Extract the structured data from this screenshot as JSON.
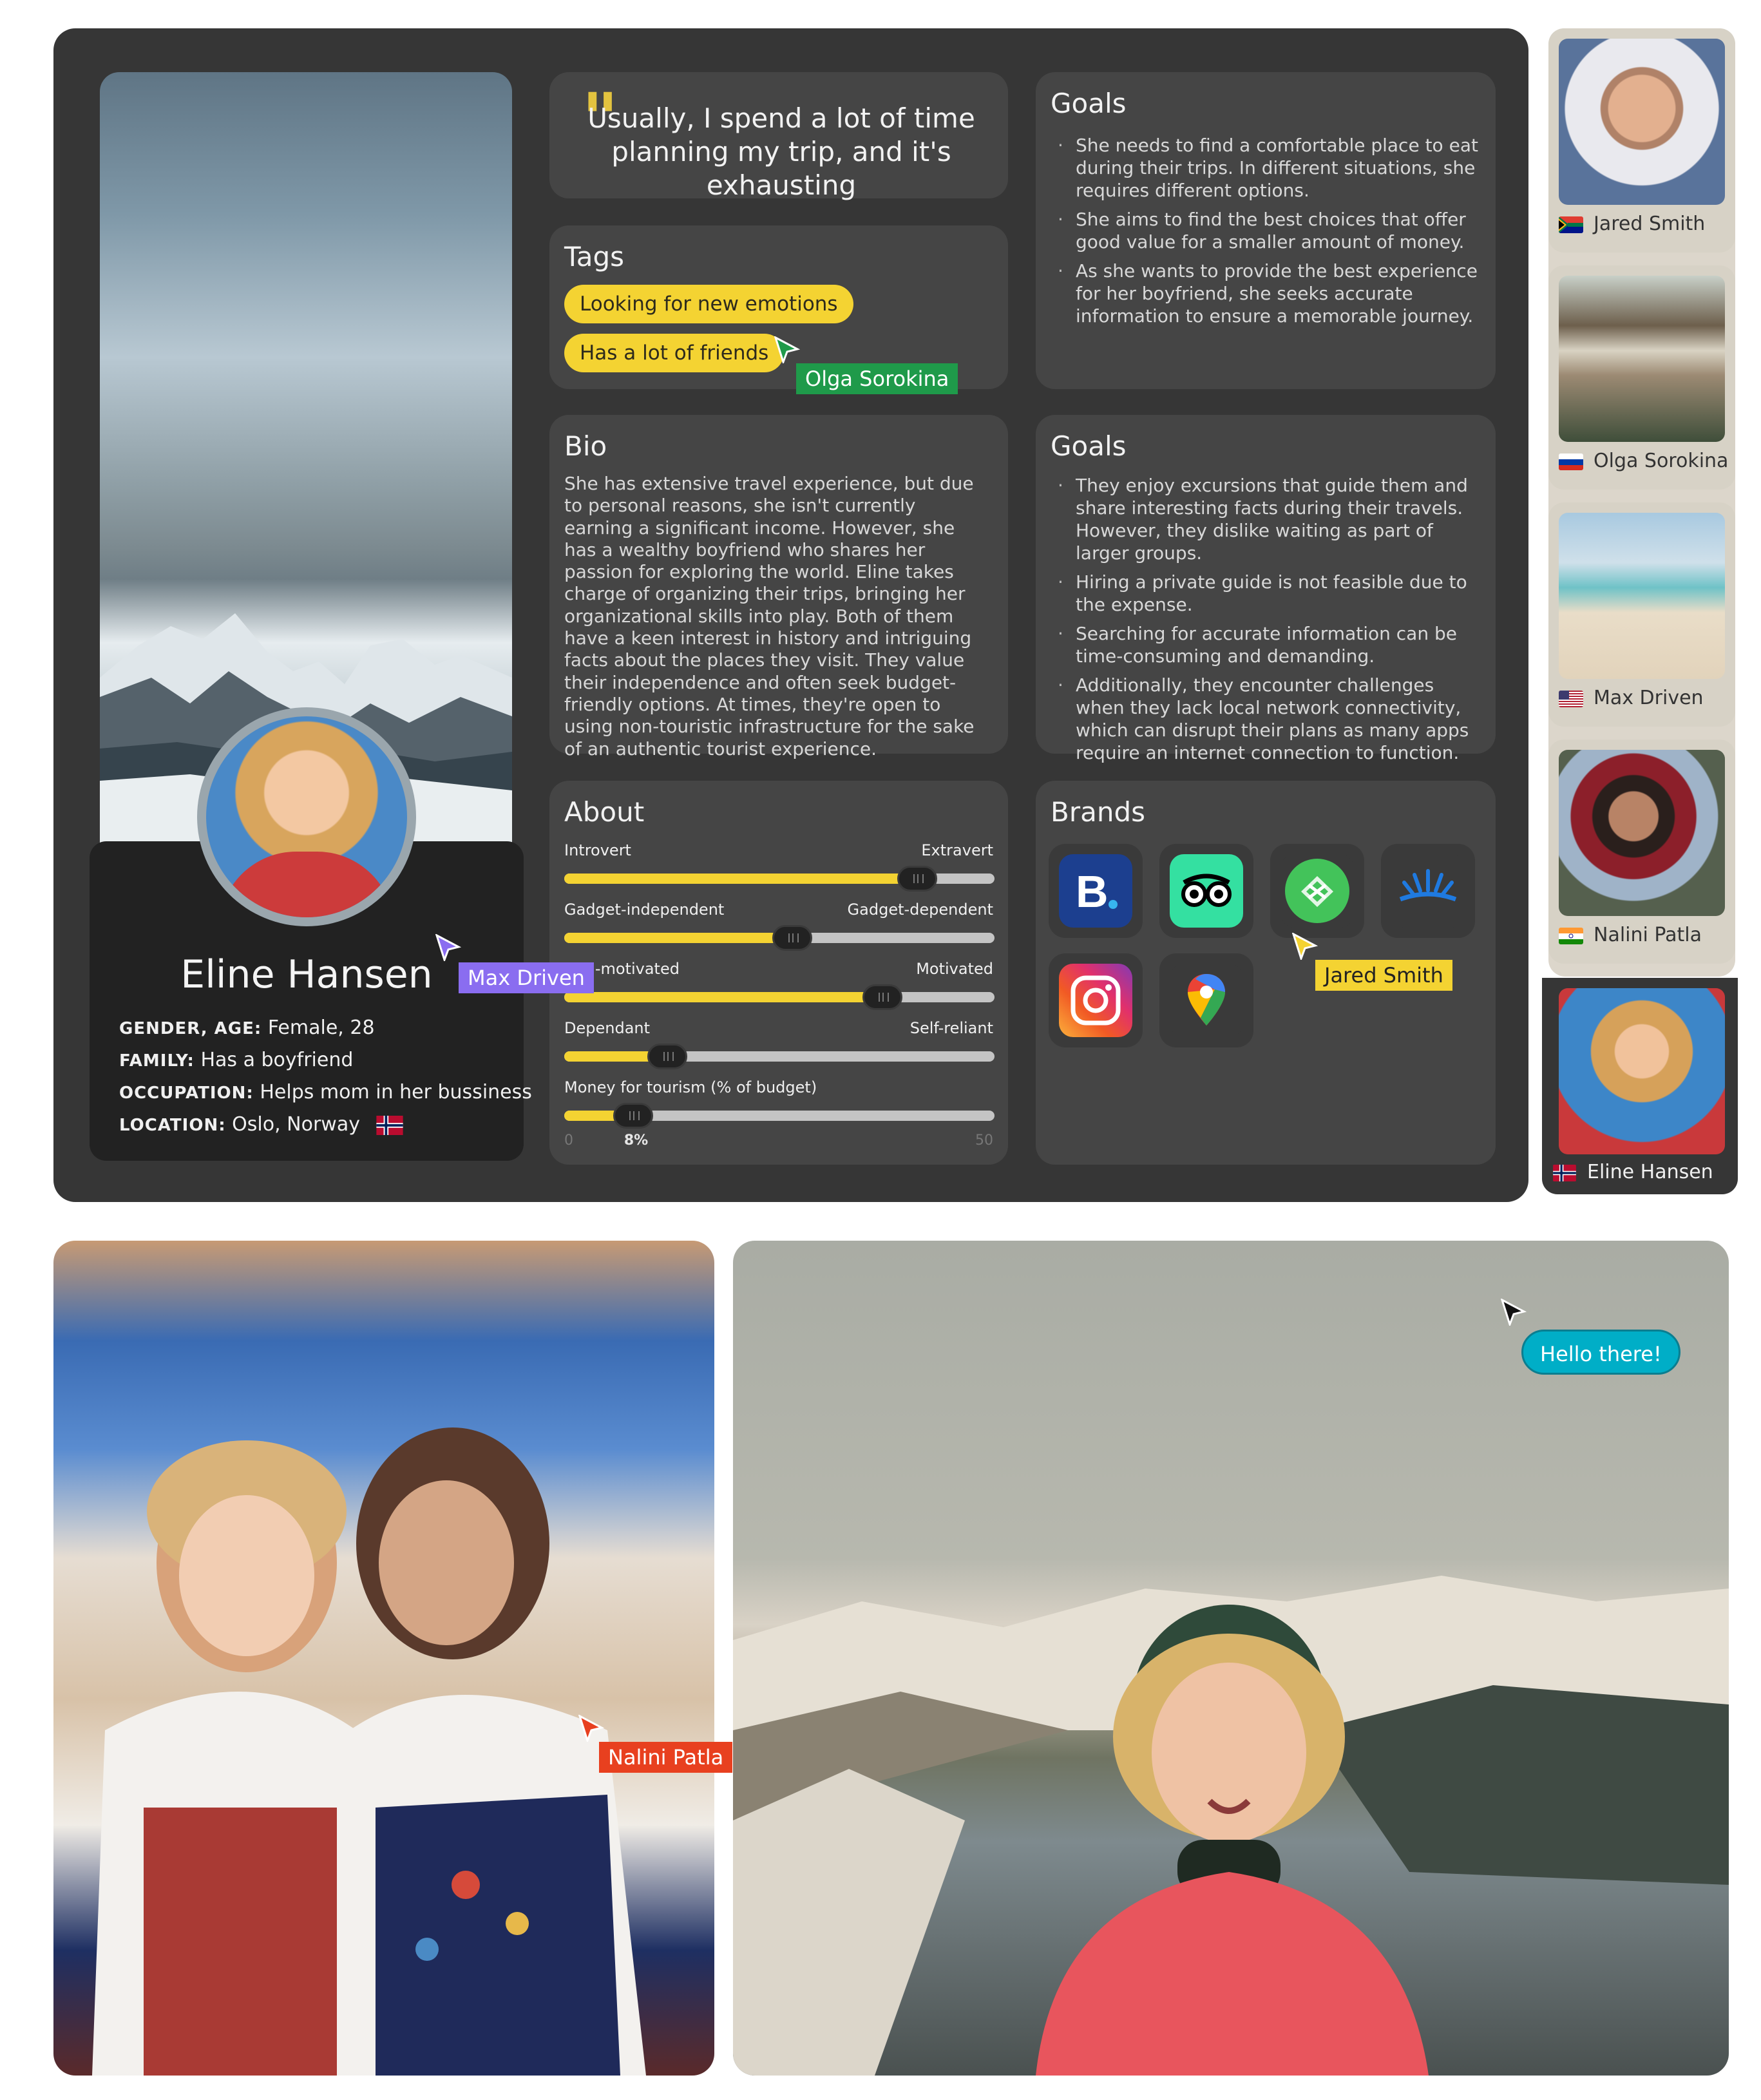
{
  "quote": "Usually, I spend a lot of time planning my trip, and it's exhausting",
  "profile": {
    "name": "Eline Hansen",
    "facts": [
      {
        "label": "GENDER, AGE:",
        "value": "Female, 28"
      },
      {
        "label": "FAMILY:",
        "value": "Has a boyfriend"
      },
      {
        "label": "OCCUPATION:",
        "value": "Helps mom in her bussiness"
      },
      {
        "label": "LOCATION:",
        "value": "Oslo, Norway"
      }
    ]
  },
  "tags": {
    "title": "Tags",
    "items": [
      "Looking for new emotions",
      "Has a lot of friends"
    ]
  },
  "goals_1": {
    "title": "Goals",
    "items": [
      "She needs to find a comfortable place to eat during their trips. In different situations, she requires different options.",
      "She aims to find the best choices that offer good value for a smaller amount of money.",
      "As she wants to provide the best experience for her boyfriend, she seeks accurate information to ensure a memorable journey."
    ]
  },
  "bio": {
    "title": "Bio",
    "text": "She has extensive travel experience, but due to personal reasons, she isn't currently earning a significant income. However, she has a wealthy boyfriend who shares her passion for exploring the world. Eline takes charge of organizing their trips, bringing her organizational skills into play. Both of them have a keen interest in history and intriguing facts about the places they visit. They value their independence and often seek budget-friendly options. At times, they're open to using non-touristic infrastructure for the sake of an authentic tourist experience."
  },
  "goals_2": {
    "title": "Goals",
    "items": [
      "They enjoy excursions that guide them and share interesting facts during their travels. However, they dislike waiting as part of larger groups.",
      "Hiring a private guide is not feasible due to the expense.",
      "Searching for accurate information can be time-consuming and demanding.",
      "Additionally, they encounter challenges when they lack local network connectivity, which can disrupt their plans as many apps require an internet connection to function."
    ]
  },
  "about": {
    "title": "About",
    "sliders": [
      {
        "left": "Introvert",
        "right": "Extravert",
        "value": 0.82
      },
      {
        "left": "Gadget-independent",
        "right": "Gadget-dependent",
        "value": 0.53
      },
      {
        "left": "Non-motivated",
        "right": "Motivated",
        "value": 0.74
      },
      {
        "left": "Dependant",
        "right": "Self-reliant",
        "value": 0.24
      }
    ],
    "money": {
      "label": "Money for tourism (% of budget)",
      "min": "0",
      "max": "50",
      "value_label": "8%",
      "value": 8
    }
  },
  "brands": {
    "title": "Brands",
    "items": [
      "booking-icon",
      "tripadvisor-icon",
      "maps-me-icon",
      "hotel-brand-icon",
      "instagram-icon",
      "google-maps-icon"
    ]
  },
  "participants": [
    {
      "name": "Jared Smith",
      "flag": "south-africa"
    },
    {
      "name": "Olga Sorokina",
      "flag": "russia"
    },
    {
      "name": "Max Driven",
      "flag": "usa"
    },
    {
      "name": "Nalini Patla",
      "flag": "india"
    },
    {
      "name": "Eline Hansen",
      "flag": "norway",
      "active": true
    }
  ],
  "cursors": [
    {
      "name": "Olga Sorokina",
      "color": "#1f9a4a"
    },
    {
      "name": "Max Driven",
      "color": "#8a6df0"
    },
    {
      "name": "Jared Smith",
      "color": "#f4d332"
    },
    {
      "name": "Nalini Patla",
      "color": "#e8401f"
    }
  ],
  "chat_bubble": "Hello there!",
  "colors": {
    "accent": "#f4d332",
    "board": "#363636",
    "panel": "#454545"
  }
}
